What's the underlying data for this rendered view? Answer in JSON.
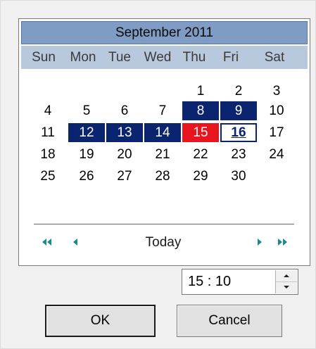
{
  "calendar": {
    "title": "September 2011",
    "weekdays": [
      "Sun",
      "Mon",
      "Tue",
      "Wed",
      "Thu",
      "Fri",
      "Sat"
    ],
    "days": [
      [
        "",
        "",
        "",
        "",
        "1",
        "2",
        "3"
      ],
      [
        "4",
        "5",
        "6",
        "7",
        "8",
        "9",
        "10"
      ],
      [
        "11",
        "12",
        "13",
        "14",
        "15",
        "16",
        "17"
      ],
      [
        "18",
        "19",
        "20",
        "21",
        "22",
        "23",
        "24"
      ],
      [
        "25",
        "26",
        "27",
        "28",
        "29",
        "30",
        ""
      ]
    ],
    "selected_days": [
      "8",
      "9",
      "12",
      "13",
      "14"
    ],
    "today_day": "15",
    "focused_day": "16",
    "colors": {
      "title_bg": "#7f9cc4",
      "weekday_bg": "#b9c9dd",
      "selection": "#0b2470",
      "today": "#e8141e"
    }
  },
  "nav": {
    "prev_year_icon": "double-left-arrow-icon",
    "prev_month_icon": "left-arrow-icon",
    "today_label": "Today",
    "next_month_icon": "right-arrow-icon",
    "next_year_icon": "double-right-arrow-icon"
  },
  "time": {
    "value": "15 : 10"
  },
  "buttons": {
    "ok": "OK",
    "cancel": "Cancel"
  }
}
